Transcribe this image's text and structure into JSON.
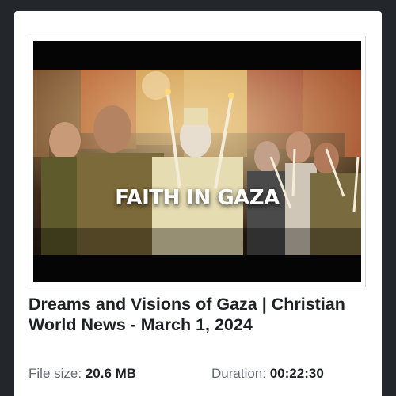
{
  "video": {
    "thumbnail_overlay_text": "FAITH IN GAZA",
    "title": "Dreams and Visions of Gaza | Christian World News - March 1, 2024",
    "file_size_label": "File size:",
    "file_size_value": "20.6 MB",
    "duration_label": "Duration:",
    "duration_value": "00:22:30"
  },
  "colors": {
    "page_background": "#23262b",
    "card_background": "#ffffff",
    "title_text": "#202124",
    "meta_label": "#666a70"
  }
}
